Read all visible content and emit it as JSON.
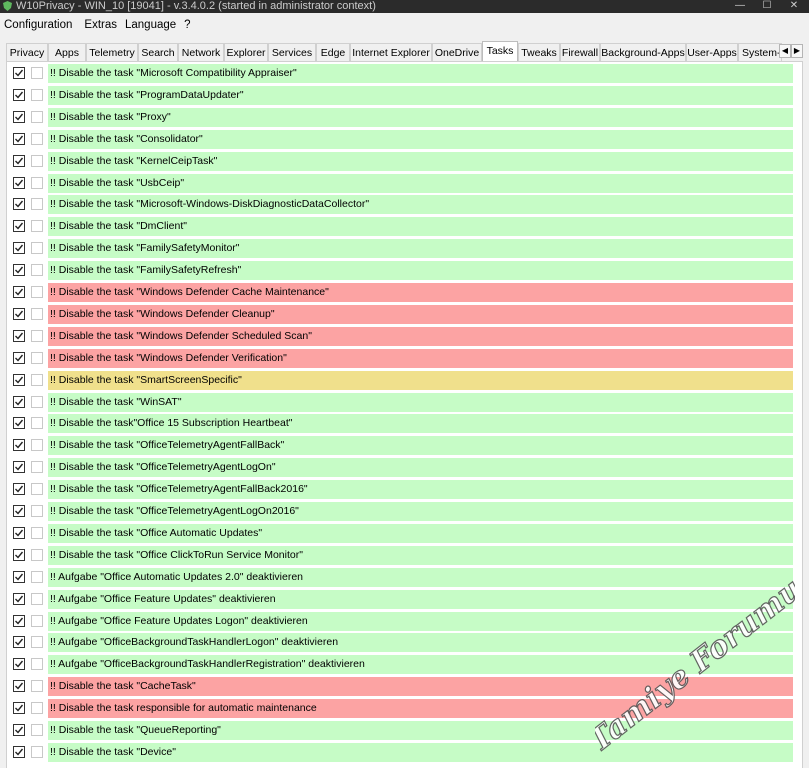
{
  "window": {
    "title": "W10Privacy - WIN_10 [19041] - v.3.4.0.2 (started in administrator context)"
  },
  "menu": [
    "Configuration",
    "Extras",
    "Language",
    "?"
  ],
  "tabs": [
    "Privacy",
    "Apps",
    "Telemetry",
    "Search",
    "Network",
    "Explorer",
    "Services",
    "Edge",
    "Internet Explorer",
    "OneDrive",
    "Tasks",
    "Tweaks",
    "Firewall",
    "Background-Apps",
    "User-Apps",
    "System-A"
  ],
  "active_tab": "Tasks",
  "colors": {
    "green": "#c6fcc6",
    "red": "#fca3a3",
    "yellow": "#f0e08c"
  },
  "rows": [
    {
      "label": "!! Disable the task \"Microsoft Compatibility Appraiser\"",
      "status": "green",
      "checked": true
    },
    {
      "label": "!! Disable the task \"ProgramDataUpdater\"",
      "status": "green",
      "checked": true
    },
    {
      "label": "!! Disable the task \"Proxy\"",
      "status": "green",
      "checked": true
    },
    {
      "label": "!! Disable the task \"Consolidator\"",
      "status": "green",
      "checked": true
    },
    {
      "label": "!! Disable the task \"KernelCeipTask\"",
      "status": "green",
      "checked": true
    },
    {
      "label": "!! Disable the task \"UsbCeip\"",
      "status": "green",
      "checked": true
    },
    {
      "label": "!! Disable the task \"Microsoft-Windows-DiskDiagnosticDataCollector\"",
      "status": "green",
      "checked": true
    },
    {
      "label": "!! Disable the task \"DmClient\"",
      "status": "green",
      "checked": true
    },
    {
      "label": "!! Disable the task \"FamilySafetyMonitor\"",
      "status": "green",
      "checked": true
    },
    {
      "label": "!! Disable the task \"FamilySafetyRefresh\"",
      "status": "green",
      "checked": true
    },
    {
      "label": "!! Disable the task \"Windows Defender Cache Maintenance\"",
      "status": "red",
      "checked": true
    },
    {
      "label": "!! Disable the task \"Windows Defender Cleanup\"",
      "status": "red",
      "checked": true
    },
    {
      "label": "!! Disable the task \"Windows Defender Scheduled Scan\"",
      "status": "red",
      "checked": true
    },
    {
      "label": "!! Disable the task \"Windows Defender Verification\"",
      "status": "red",
      "checked": true
    },
    {
      "label": "!! Disable the task \"SmartScreenSpecific\"",
      "status": "yellow",
      "checked": true
    },
    {
      "label": "!! Disable the task \"WinSAT\"",
      "status": "green",
      "checked": true
    },
    {
      "label": "!! Disable the task\"Office 15 Subscription Heartbeat\"",
      "status": "green",
      "checked": true
    },
    {
      "label": "!! Disable the task \"OfficeTelemetryAgentFallBack\"",
      "status": "green",
      "checked": true
    },
    {
      "label": "!! Disable the task \"OfficeTelemetryAgentLogOn\"",
      "status": "green",
      "checked": true
    },
    {
      "label": "!! Disable the task \"OfficeTelemetryAgentFallBack2016\"",
      "status": "green",
      "checked": true
    },
    {
      "label": "!! Disable the task \"OfficeTelemetryAgentLogOn2016\"",
      "status": "green",
      "checked": true
    },
    {
      "label": "!! Disable the task \"Office Automatic Updates\"",
      "status": "green",
      "checked": true
    },
    {
      "label": "!! Disable the task \"Office ClickToRun Service Monitor\"",
      "status": "green",
      "checked": true
    },
    {
      "label": "!! Aufgabe \"Office Automatic Updates 2.0\" deaktivieren",
      "status": "green",
      "checked": true
    },
    {
      "label": "!! Aufgabe \"Office Feature Updates\" deaktivieren",
      "status": "green",
      "checked": true
    },
    {
      "label": "!! Aufgabe \"Office Feature Updates Logon\" deaktivieren",
      "status": "green",
      "checked": true
    },
    {
      "label": "!! Aufgabe \"OfficeBackgroundTaskHandlerLogon\" deaktivieren",
      "status": "green",
      "checked": true
    },
    {
      "label": "!! Aufgabe \"OfficeBackgroundTaskHandlerRegistration\" deaktivieren",
      "status": "green",
      "checked": true
    },
    {
      "label": "!! Disable the task \"CacheTask\"",
      "status": "red",
      "checked": true
    },
    {
      "label": "!! Disable the task responsible for automatic maintenance",
      "status": "red",
      "checked": true
    },
    {
      "label": "!! Disable the task \"QueueReporting\"",
      "status": "green",
      "checked": true
    },
    {
      "label": "!! Disable the task \"Device\"",
      "status": "green",
      "checked": true
    }
  ],
  "watermark": "Tamiye Forumu"
}
